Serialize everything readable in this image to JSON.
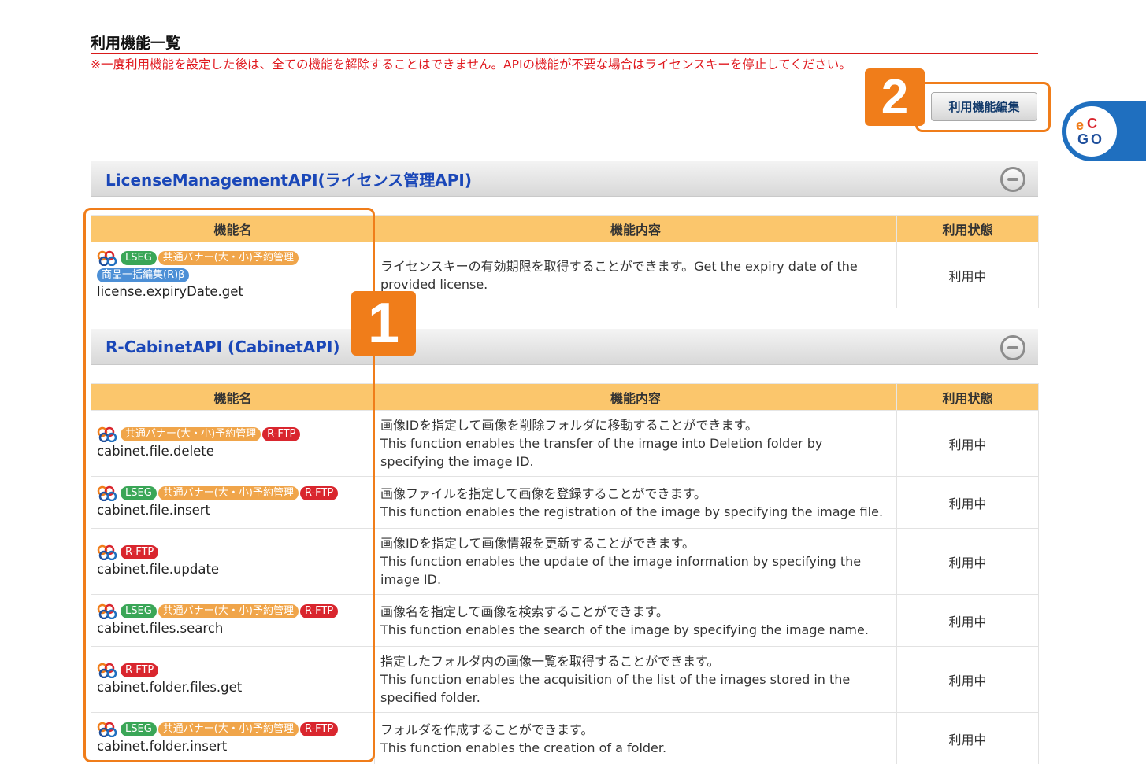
{
  "page": {
    "title": "利用機能一覧",
    "warning": "※一度利用機能を設定した後は、全ての機能を解除することはできません。APIの機能が不要な場合はライセンスキーを停止してください。",
    "edit_button": "利用機能編集",
    "callouts": [
      "1",
      "2"
    ]
  },
  "colors": {
    "accent": "#f07d1a",
    "header": "#fbc66c",
    "link": "#1a47b8",
    "status": "#2a9d3c",
    "warning": "#e0181e"
  },
  "columns": {
    "name": "機能名",
    "desc": "機能内容",
    "status": "利用状態"
  },
  "sections": [
    {
      "title": "LicenseManagementAPI(ライセンス管理API)",
      "rows": [
        {
          "name": "license.expiryDate.get",
          "badges": [
            "LSEG",
            "共通バナー(大・小)予約管理",
            "商品一括編集(R)β"
          ],
          "desc": [
            "ライセンスキーの有効期限を取得することができます。Get the expiry date of the",
            "provided license."
          ],
          "status": "利用中"
        }
      ]
    },
    {
      "title": "R-CabinetAPI (CabinetAPI)",
      "rows": [
        {
          "name": "cabinet.file.delete",
          "badges": [
            "共通バナー(大・小)予約管理",
            "R-FTP"
          ],
          "desc": [
            "画像IDを指定して画像を削除フォルダに移動することができます。",
            "This function enables the transfer of the image into Deletion folder by",
            "specifying the image ID."
          ],
          "status": "利用中"
        },
        {
          "name": "cabinet.file.insert",
          "badges": [
            "LSEG",
            "共通バナー(大・小)予約管理",
            "R-FTP"
          ],
          "desc": [
            "画像ファイルを指定して画像を登録することができます。",
            "This function enables the registration of the image by specifying the image file."
          ],
          "status": "利用中"
        },
        {
          "name": "cabinet.file.update",
          "badges": [
            "R-FTP"
          ],
          "desc": [
            "画像IDを指定して画像情報を更新することができます。",
            "This function enables the update of the image information by specifying the",
            "image ID."
          ],
          "status": "利用中"
        },
        {
          "name": "cabinet.files.search",
          "badges": [
            "LSEG",
            "共通バナー(大・小)予約管理",
            "R-FTP"
          ],
          "desc": [
            "画像名を指定して画像を検索することができます。",
            "This function enables the search of the image by specifying the image name."
          ],
          "status": "利用中"
        },
        {
          "name": "cabinet.folder.files.get",
          "badges": [
            "R-FTP"
          ],
          "desc": [
            "指定したフォルダ内の画像一覧を取得することができます。",
            "This function enables the acquisition of the list of the images stored in the",
            "specified folder."
          ],
          "status": "利用中"
        },
        {
          "name": "cabinet.folder.insert",
          "badges": [
            "LSEG",
            "共通バナー(大・小)予約管理",
            "R-FTP"
          ],
          "desc": [
            "フォルダを作成することができます。",
            "This function enables the creation of a folder."
          ],
          "status": "利用中"
        }
      ]
    }
  ]
}
